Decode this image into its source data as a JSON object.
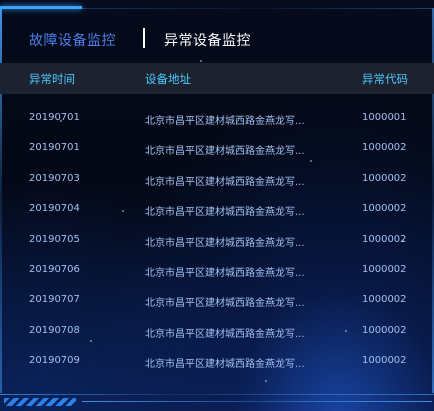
{
  "tabs": [
    {
      "label": "故障设备监控"
    },
    {
      "label": "异常设备监控"
    }
  ],
  "table": {
    "headers": {
      "date": "异常时间",
      "address": "设备地址",
      "code": "异常代码"
    },
    "rows": [
      {
        "date": "20190701",
        "address": "北京市昌平区建材城西路金燕龙写...",
        "code": "1000001"
      },
      {
        "date": "20190701",
        "address": "北京市昌平区建材城西路金燕龙写...",
        "code": "1000002"
      },
      {
        "date": "20190703",
        "address": "北京市昌平区建材城西路金燕龙写...",
        "code": "1000002"
      },
      {
        "date": "20190704",
        "address": "北京市昌平区建材城西路金燕龙写...",
        "code": "1000002"
      },
      {
        "date": "20190705",
        "address": "北京市昌平区建材城西路金燕龙写...",
        "code": "1000002"
      },
      {
        "date": "20190706",
        "address": "北京市昌平区建材城西路金燕龙写...",
        "code": "1000002"
      },
      {
        "date": "20190707",
        "address": "北京市昌平区建材城西路金燕龙写...",
        "code": "1000002"
      },
      {
        "date": "20190708",
        "address": "北京市昌平区建材城西路金燕龙写...",
        "code": "1000002"
      },
      {
        "date": "20190709",
        "address": "北京市昌平区建材城西路金燕龙写...",
        "code": "1000002"
      }
    ]
  },
  "colors": {
    "background": "#030815",
    "active_tab": "#ffffff",
    "inactive_tab": "#4d7fe8",
    "header_text": "#4cc8ff",
    "header_bg": "#1d232e",
    "cell_text": "#a2c0f0",
    "frame_accent": "#3aa2ff"
  }
}
